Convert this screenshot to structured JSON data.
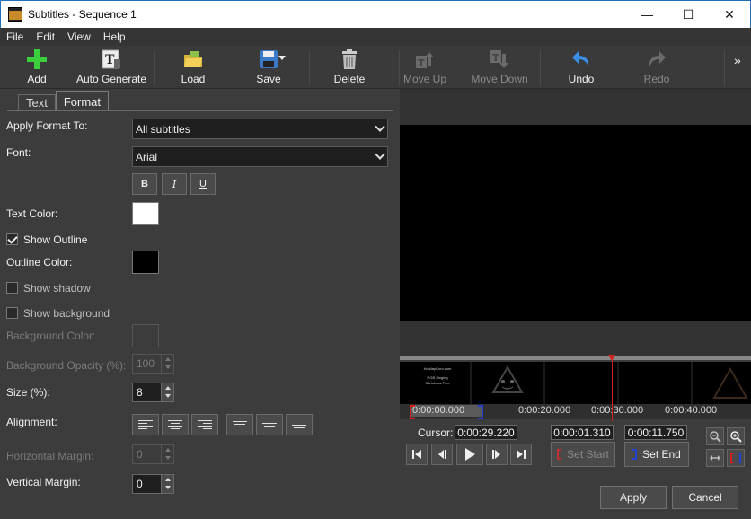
{
  "window": {
    "title": "Subtitles - Sequence 1",
    "minimize": "—",
    "maximize": "☐",
    "close": "✕"
  },
  "menu": [
    "File",
    "Edit",
    "View",
    "Help"
  ],
  "toolbar": {
    "add": "Add",
    "auto_generate": "Auto Generate",
    "load": "Load",
    "save": "Save",
    "delete": "Delete",
    "move_up": "Move Up",
    "move_down": "Move Down",
    "undo": "Undo",
    "redo": "Redo",
    "overflow": "»"
  },
  "tabs": {
    "text": "Text",
    "format": "Format"
  },
  "format": {
    "apply_format_to_label": "Apply Format To:",
    "apply_format_to_value": "All subtitles",
    "font_label": "Font:",
    "font_value": "Arial",
    "bold": "B",
    "italic": "I",
    "underline": "U",
    "text_color_label": "Text Color:",
    "text_color": "#ffffff",
    "show_outline_label": "Show Outline",
    "show_outline": true,
    "outline_color_label": "Outline Color:",
    "outline_color": "#000000",
    "show_shadow_label": "Show shadow",
    "show_shadow": false,
    "show_background_label": "Show background",
    "show_background": false,
    "background_color_label": "Background Color:",
    "background_opacity_label": "Background Opacity (%):",
    "background_opacity_value": "100",
    "size_label": "Size (%):",
    "size_value": "8",
    "alignment_label": "Alignment:",
    "horizontal_margin_label": "Horizontal Margin:",
    "horizontal_margin_value": "0",
    "vertical_margin_label": "Vertical Margin:",
    "vertical_margin_value": "0"
  },
  "timeline": {
    "thumb1_line1": "HolidayCoro.com",
    "thumb1_line2": "RGB Singing",
    "thumb1_line3": "Christmas Tree",
    "ruler_start": "0:00:00.000",
    "ruler_mid": "0:00:20.000",
    "ruler_30": "0:00:30.000",
    "ruler_40": "0:00:40.000"
  },
  "controls": {
    "cursor_label": "Cursor:",
    "cursor_value": "0:00:29.220",
    "start_value": "0:00:01.310",
    "end_value": "0:00:11.750",
    "set_start": "Set Start",
    "set_end": "Set End"
  },
  "buttons": {
    "apply": "Apply",
    "cancel": "Cancel"
  },
  "colors": {
    "accent_red": "#d02020",
    "accent_blue": "#2040d0",
    "add_green": "#3ccf3c",
    "undo_blue": "#3a8ee6"
  }
}
